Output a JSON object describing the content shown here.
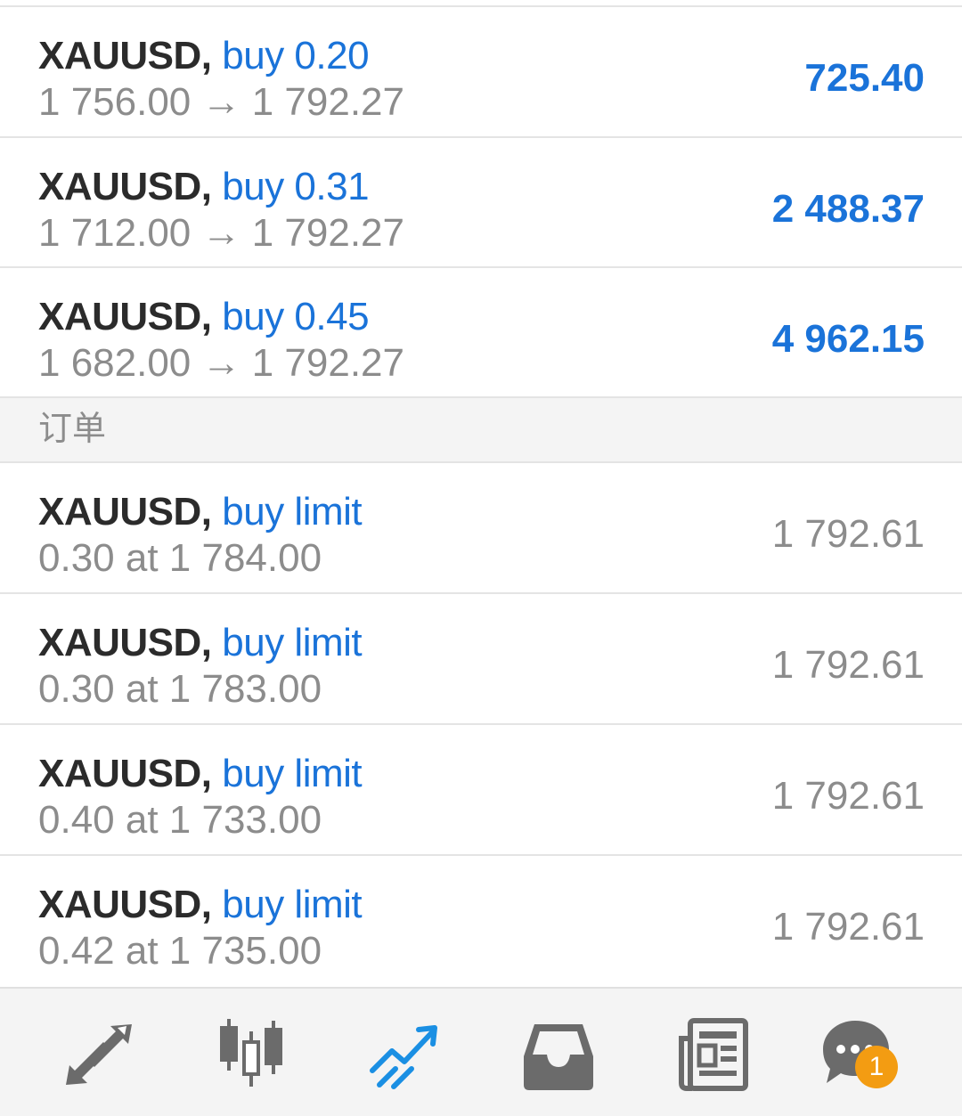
{
  "positions": [
    {
      "symbol": "XAUUSD,",
      "type": "buy 0.20",
      "prices": "1 756.00 → 1 792.27",
      "profit": "725.40"
    },
    {
      "symbol": "XAUUSD,",
      "type": "buy 0.31",
      "prices": "1 712.00 → 1 792.27",
      "profit": "2 488.37"
    },
    {
      "symbol": "XAUUSD,",
      "type": "buy 0.45",
      "prices": "1 682.00 → 1 792.27",
      "profit": "4 962.15"
    }
  ],
  "orders_section": {
    "title": "订单"
  },
  "orders": [
    {
      "symbol": "XAUUSD,",
      "type": "buy limit",
      "details": "0.30 at 1 784.00",
      "price": "1 792.61"
    },
    {
      "symbol": "XAUUSD,",
      "type": "buy limit",
      "details": "0.30 at 1 783.00",
      "price": "1 792.61"
    },
    {
      "symbol": "XAUUSD,",
      "type": "buy limit",
      "details": "0.40 at 1 733.00",
      "price": "1 792.61"
    },
    {
      "symbol": "XAUUSD,",
      "type": "buy limit",
      "details": "0.42 at 1 735.00",
      "price": "1 792.61"
    }
  ],
  "tabbar": {
    "tabs": [
      {
        "icon": "quotes-arrows-icon",
        "active": false
      },
      {
        "icon": "candlestick-chart-icon",
        "active": false
      },
      {
        "icon": "trade-trend-icon",
        "active": true
      },
      {
        "icon": "history-inbox-icon",
        "active": false
      },
      {
        "icon": "news-icon",
        "active": false
      },
      {
        "icon": "chat-icon",
        "active": false,
        "badge": "1"
      }
    ]
  },
  "colors": {
    "accent_blue": "#1a73d9",
    "icon_gray": "#6b6b6b",
    "badge_orange": "#f39c12"
  }
}
